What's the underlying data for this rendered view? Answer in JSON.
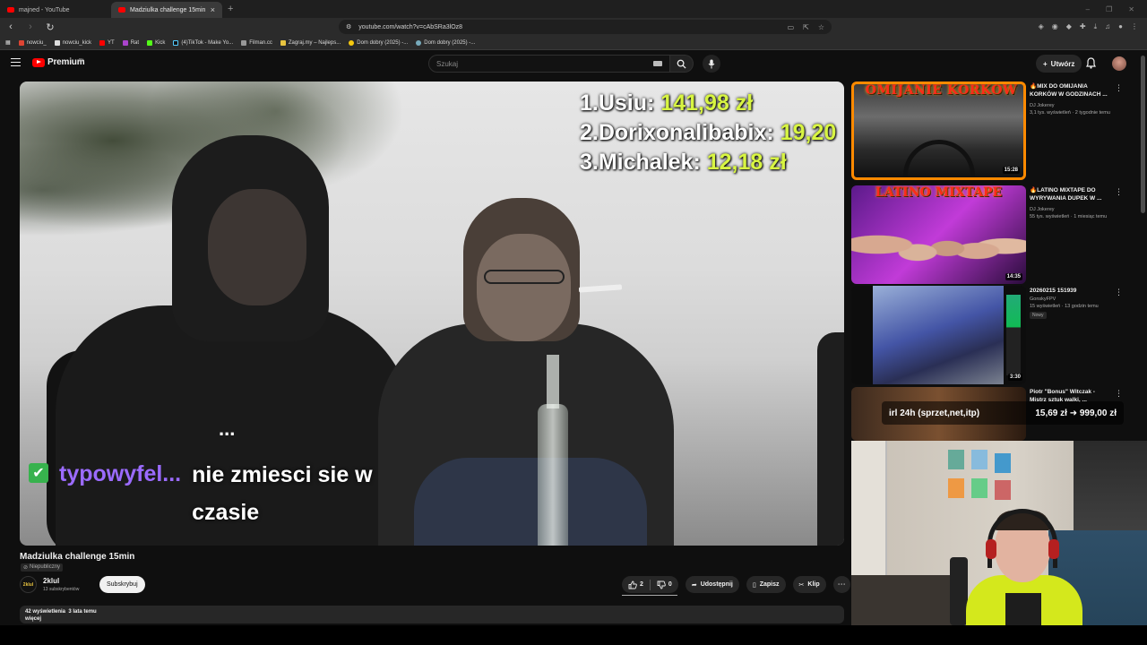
{
  "browser": {
    "tabs": [
      {
        "title": "majned - YouTube",
        "active": false
      },
      {
        "title": "Madziulka challenge 15min",
        "active": true
      }
    ],
    "url": "youtube.com/watch?v=cAbSRa3lOz8",
    "bookmarks": [
      "nowciu_",
      "nowciu_kick",
      "YT",
      "Rat",
      "Kick",
      "(4)TikTok - Make Yo...",
      "Filman.cc",
      "Zagraj.my – Najleps...",
      "Dom dobry (2025) -...",
      "Dom dobry (2025) -..."
    ]
  },
  "youtube": {
    "logo_text": "Premium",
    "region": "PL",
    "search_placeholder": "Szukaj",
    "create_label": "Utwórz"
  },
  "video": {
    "overlay_ranking": [
      {
        "label": "1.Usiu: ",
        "amount": "141,98 zł"
      },
      {
        "label": "2.Dorixonalibabix: ",
        "amount": "19,20"
      },
      {
        "label": "3.Michalek: ",
        "amount": "12,18 zł"
      }
    ],
    "chat_user": "typowyfel...",
    "chat_text": "nie zmiesci sie w czasie",
    "chat_prev": "..."
  },
  "details": {
    "title": "Madziulka challenge 15min",
    "visibility": "Niepubliczny",
    "channel_avatar_text": "2klul",
    "channel": "2klul",
    "subscribers": "13 subskrybentów",
    "subscribe_label": "Subskrybuj",
    "likes": "2",
    "dislikes": "0",
    "share_label": "Udostępnij",
    "save_label": "Zapisz",
    "clip_label": "Klip",
    "views": "42 wyświetlenia",
    "date": "3 lata temu",
    "more_label": "więcej"
  },
  "related": [
    {
      "title": "MIX DO OMIJANIA KORKÓW W GODZINACH ...",
      "channel": "DJ Jokerey",
      "meta": "3,1 tys. wyświetleń · 2 tygodnie temu",
      "duration": "15:28",
      "thumb_text": "OMIJANIE KORKÓW",
      "fire": true
    },
    {
      "title": "LATINO MIXTAPE DO WYRYWANIA DUPEK W ...",
      "channel": "DJ Jokerey",
      "meta": "55 tys. wyświetleń · 1 miesiąc temu",
      "duration": "14:35",
      "thumb_text": "LATINO MIXTAPE",
      "fire": true
    },
    {
      "title": "20260215 151939",
      "channel": "GonskyFPV",
      "meta": "15 wyświetleń · 13 godzin temu",
      "duration": "3:30",
      "badge": "Nowy",
      "fire": false
    },
    {
      "title": "Piotr \"Bonus\" Witczak - Mistrz sztuk walki, ...",
      "channel": "",
      "meta": "",
      "duration": "",
      "fire": false
    }
  ],
  "stream_overlay": {
    "label": "irl 24h (sprzet,net,itp)",
    "amounts": "15,69 zł ➜ 999,00 zł"
  }
}
